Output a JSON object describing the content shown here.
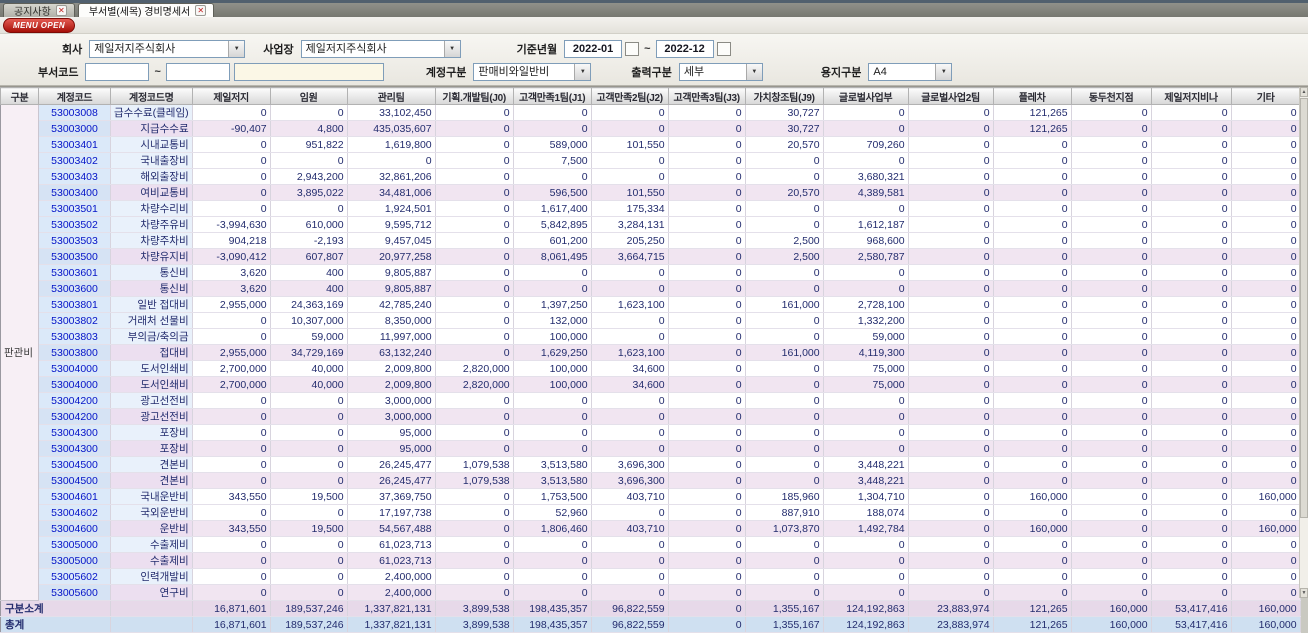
{
  "tabs": [
    {
      "label": "공지사항"
    },
    {
      "label": "부서별(세목) 경비명세서"
    }
  ],
  "menu_button": "MENU OPEN",
  "filters": {
    "company_label": "회사",
    "company_value": "제일저지주식회사",
    "workplace_label": "사업장",
    "workplace_value": "제일저지주식회사",
    "period_label": "기준년월",
    "period_from": "2022-01",
    "period_to": "2022-12",
    "tilde": "~",
    "dept_code_label": "부서코드",
    "account_type_label": "계정구분",
    "account_type_value": "판매비와일반비",
    "output_type_label": "출력구분",
    "output_type_value": "세부",
    "paper_type_label": "용지구분",
    "paper_type_value": "A4"
  },
  "table": {
    "group_label": "판관비",
    "headers": [
      "구분",
      "계정코드",
      "계정코드명",
      "제일저지",
      "임원",
      "관리팀",
      "기획.개발팀(J0)",
      "고객만족1팀(J1)",
      "고객만족2팀(J2)",
      "고객만족3팀(J3)",
      "가치창조팀(J9)",
      "글로벌사업부",
      "글로벌사업2팀",
      "플레차",
      "동두천지점",
      "제일저지비나",
      "기타"
    ],
    "rows": [
      {
        "code": "53003008",
        "name": "급수수료(클레임)",
        "subtotal": false,
        "values": [
          "0",
          "0",
          "33,102,450",
          "0",
          "0",
          "0",
          "0",
          "30,727",
          "0",
          "0",
          "121,265",
          "0",
          "0",
          "0"
        ]
      },
      {
        "code": "53003000",
        "name": "지급수수료",
        "subtotal": true,
        "values": [
          "-90,407",
          "4,800",
          "435,035,607",
          "0",
          "0",
          "0",
          "0",
          "30,727",
          "0",
          "0",
          "121,265",
          "0",
          "0",
          "0"
        ]
      },
      {
        "code": "53003401",
        "name": "시내교통비",
        "subtotal": false,
        "values": [
          "0",
          "951,822",
          "1,619,800",
          "0",
          "589,000",
          "101,550",
          "0",
          "20,570",
          "709,260",
          "0",
          "0",
          "0",
          "0",
          "0"
        ]
      },
      {
        "code": "53003402",
        "name": "국내출장비",
        "subtotal": false,
        "values": [
          "0",
          "0",
          "0",
          "0",
          "7,500",
          "0",
          "0",
          "0",
          "0",
          "0",
          "0",
          "0",
          "0",
          "0"
        ]
      },
      {
        "code": "53003403",
        "name": "해외출장비",
        "subtotal": false,
        "values": [
          "0",
          "2,943,200",
          "32,861,206",
          "0",
          "0",
          "0",
          "0",
          "0",
          "3,680,321",
          "0",
          "0",
          "0",
          "0",
          "0"
        ]
      },
      {
        "code": "53003400",
        "name": "여비교통비",
        "subtotal": true,
        "values": [
          "0",
          "3,895,022",
          "34,481,006",
          "0",
          "596,500",
          "101,550",
          "0",
          "20,570",
          "4,389,581",
          "0",
          "0",
          "0",
          "0",
          "0"
        ]
      },
      {
        "code": "53003501",
        "name": "차량수리비",
        "subtotal": false,
        "values": [
          "0",
          "0",
          "1,924,501",
          "0",
          "1,617,400",
          "175,334",
          "0",
          "0",
          "0",
          "0",
          "0",
          "0",
          "0",
          "0"
        ]
      },
      {
        "code": "53003502",
        "name": "차량주유비",
        "subtotal": false,
        "values": [
          "-3,994,630",
          "610,000",
          "9,595,712",
          "0",
          "5,842,895",
          "3,284,131",
          "0",
          "0",
          "1,612,187",
          "0",
          "0",
          "0",
          "0",
          "0"
        ]
      },
      {
        "code": "53003503",
        "name": "차량주차비",
        "subtotal": false,
        "values": [
          "904,218",
          "-2,193",
          "9,457,045",
          "0",
          "601,200",
          "205,250",
          "0",
          "2,500",
          "968,600",
          "0",
          "0",
          "0",
          "0",
          "0"
        ]
      },
      {
        "code": "53003500",
        "name": "차량유지비",
        "subtotal": true,
        "values": [
          "-3,090,412",
          "607,807",
          "20,977,258",
          "0",
          "8,061,495",
          "3,664,715",
          "0",
          "2,500",
          "2,580,787",
          "0",
          "0",
          "0",
          "0",
          "0"
        ]
      },
      {
        "code": "53003601",
        "name": "통신비",
        "subtotal": false,
        "values": [
          "3,620",
          "400",
          "9,805,887",
          "0",
          "0",
          "0",
          "0",
          "0",
          "0",
          "0",
          "0",
          "0",
          "0",
          "0"
        ]
      },
      {
        "code": "53003600",
        "name": "통신비",
        "subtotal": true,
        "values": [
          "3,620",
          "400",
          "9,805,887",
          "0",
          "0",
          "0",
          "0",
          "0",
          "0",
          "0",
          "0",
          "0",
          "0",
          "0"
        ]
      },
      {
        "code": "53003801",
        "name": "일반 접대비",
        "subtotal": false,
        "values": [
          "2,955,000",
          "24,363,169",
          "42,785,240",
          "0",
          "1,397,250",
          "1,623,100",
          "0",
          "161,000",
          "2,728,100",
          "0",
          "0",
          "0",
          "0",
          "0"
        ]
      },
      {
        "code": "53003802",
        "name": "거래처 선물비",
        "subtotal": false,
        "values": [
          "0",
          "10,307,000",
          "8,350,000",
          "0",
          "132,000",
          "0",
          "0",
          "0",
          "1,332,200",
          "0",
          "0",
          "0",
          "0",
          "0"
        ]
      },
      {
        "code": "53003803",
        "name": "부의금/축의금",
        "subtotal": false,
        "values": [
          "0",
          "59,000",
          "11,997,000",
          "0",
          "100,000",
          "0",
          "0",
          "0",
          "59,000",
          "0",
          "0",
          "0",
          "0",
          "0"
        ]
      },
      {
        "code": "53003800",
        "name": "접대비",
        "subtotal": true,
        "values": [
          "2,955,000",
          "34,729,169",
          "63,132,240",
          "0",
          "1,629,250",
          "1,623,100",
          "0",
          "161,000",
          "4,119,300",
          "0",
          "0",
          "0",
          "0",
          "0"
        ]
      },
      {
        "code": "53004000",
        "name": "도서인쇄비",
        "subtotal": false,
        "values": [
          "2,700,000",
          "40,000",
          "2,009,800",
          "2,820,000",
          "100,000",
          "34,600",
          "0",
          "0",
          "75,000",
          "0",
          "0",
          "0",
          "0",
          "0"
        ]
      },
      {
        "code": "53004000",
        "name": "도서인쇄비",
        "subtotal": true,
        "values": [
          "2,700,000",
          "40,000",
          "2,009,800",
          "2,820,000",
          "100,000",
          "34,600",
          "0",
          "0",
          "75,000",
          "0",
          "0",
          "0",
          "0",
          "0"
        ]
      },
      {
        "code": "53004200",
        "name": "광고선전비",
        "subtotal": false,
        "values": [
          "0",
          "0",
          "3,000,000",
          "0",
          "0",
          "0",
          "0",
          "0",
          "0",
          "0",
          "0",
          "0",
          "0",
          "0"
        ]
      },
      {
        "code": "53004200",
        "name": "광고선전비",
        "subtotal": true,
        "values": [
          "0",
          "0",
          "3,000,000",
          "0",
          "0",
          "0",
          "0",
          "0",
          "0",
          "0",
          "0",
          "0",
          "0",
          "0"
        ]
      },
      {
        "code": "53004300",
        "name": "포장비",
        "subtotal": false,
        "values": [
          "0",
          "0",
          "95,000",
          "0",
          "0",
          "0",
          "0",
          "0",
          "0",
          "0",
          "0",
          "0",
          "0",
          "0"
        ]
      },
      {
        "code": "53004300",
        "name": "포장비",
        "subtotal": true,
        "values": [
          "0",
          "0",
          "95,000",
          "0",
          "0",
          "0",
          "0",
          "0",
          "0",
          "0",
          "0",
          "0",
          "0",
          "0"
        ]
      },
      {
        "code": "53004500",
        "name": "견본비",
        "subtotal": false,
        "values": [
          "0",
          "0",
          "26,245,477",
          "1,079,538",
          "3,513,580",
          "3,696,300",
          "0",
          "0",
          "3,448,221",
          "0",
          "0",
          "0",
          "0",
          "0"
        ]
      },
      {
        "code": "53004500",
        "name": "견본비",
        "subtotal": true,
        "values": [
          "0",
          "0",
          "26,245,477",
          "1,079,538",
          "3,513,580",
          "3,696,300",
          "0",
          "0",
          "3,448,221",
          "0",
          "0",
          "0",
          "0",
          "0"
        ]
      },
      {
        "code": "53004601",
        "name": "국내운반비",
        "subtotal": false,
        "values": [
          "343,550",
          "19,500",
          "37,369,750",
          "0",
          "1,753,500",
          "403,710",
          "0",
          "185,960",
          "1,304,710",
          "0",
          "160,000",
          "0",
          "0",
          "160,000"
        ]
      },
      {
        "code": "53004602",
        "name": "국외운반비",
        "subtotal": false,
        "values": [
          "0",
          "0",
          "17,197,738",
          "0",
          "52,960",
          "0",
          "0",
          "887,910",
          "188,074",
          "0",
          "0",
          "0",
          "0",
          "0"
        ]
      },
      {
        "code": "53004600",
        "name": "운반비",
        "subtotal": true,
        "values": [
          "343,550",
          "19,500",
          "54,567,488",
          "0",
          "1,806,460",
          "403,710",
          "0",
          "1,073,870",
          "1,492,784",
          "0",
          "160,000",
          "0",
          "0",
          "160,000"
        ]
      },
      {
        "code": "53005000",
        "name": "수출제비",
        "subtotal": false,
        "values": [
          "0",
          "0",
          "61,023,713",
          "0",
          "0",
          "0",
          "0",
          "0",
          "0",
          "0",
          "0",
          "0",
          "0",
          "0"
        ]
      },
      {
        "code": "53005000",
        "name": "수출제비",
        "subtotal": true,
        "values": [
          "0",
          "0",
          "61,023,713",
          "0",
          "0",
          "0",
          "0",
          "0",
          "0",
          "0",
          "0",
          "0",
          "0",
          "0"
        ]
      },
      {
        "code": "53005602",
        "name": "인력개발비",
        "subtotal": false,
        "values": [
          "0",
          "0",
          "2,400,000",
          "0",
          "0",
          "0",
          "0",
          "0",
          "0",
          "0",
          "0",
          "0",
          "0",
          "0"
        ]
      },
      {
        "code": "53005600",
        "name": "연구비",
        "subtotal": true,
        "values": [
          "0",
          "0",
          "2,400,000",
          "0",
          "0",
          "0",
          "0",
          "0",
          "0",
          "0",
          "0",
          "0",
          "0",
          "0"
        ]
      }
    ],
    "footer": [
      {
        "label": "구분소계",
        "values": [
          "16,871,601",
          "189,537,246",
          "1,337,821,131",
          "3,899,538",
          "198,435,357",
          "96,822,559",
          "0",
          "1,355,167",
          "124,192,863",
          "23,883,974",
          "121,265",
          "160,000",
          "53,417,416",
          "160,000"
        ]
      },
      {
        "label": "총계",
        "values": [
          "16,871,601",
          "189,537,246",
          "1,337,821,131",
          "3,899,538",
          "198,435,357",
          "96,822,559",
          "0",
          "1,355,167",
          "124,192,863",
          "23,883,974",
          "121,265",
          "160,000",
          "53,417,416",
          "160,000"
        ]
      }
    ]
  }
}
